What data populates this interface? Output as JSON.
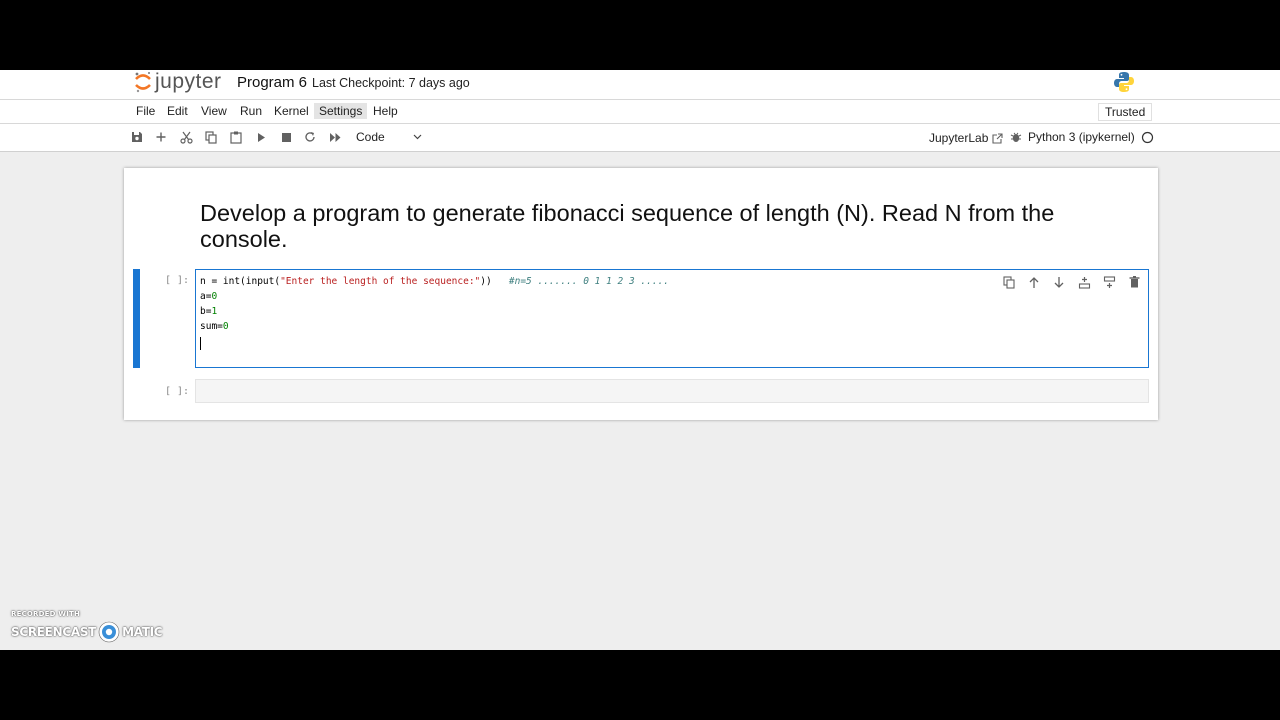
{
  "app": {
    "logo_text": "jupyter",
    "notebook_title": "Program 6",
    "checkpoint": "Last Checkpoint: 7 days ago"
  },
  "menu": {
    "items": [
      "File",
      "Edit",
      "View",
      "Run",
      "Kernel",
      "Settings",
      "Help"
    ],
    "active": "Settings",
    "trusted": "Trusted"
  },
  "toolbar": {
    "icons": [
      "save-icon",
      "add-cell-icon",
      "cut-icon",
      "copy-icon",
      "paste-icon",
      "run-icon",
      "stop-icon",
      "restart-icon",
      "run-all-icon"
    ],
    "cell_type": "Code",
    "jupyterlab_link": "JupyterLab",
    "kernel_name": "Python 3 (ipykernel)",
    "kernel_state": "idle"
  },
  "cells": {
    "markdown_text": "Develop a program to generate fibonacci sequence of length (N). Read N from the console.",
    "code_prompt": "[ ]:",
    "code_lines": {
      "l1_a": "n = int(input(",
      "l1_str": "\"Enter the length of the sequence:\"",
      "l1_b": "))   ",
      "l1_comment": "#n=5 ....... 0 1 1 2 3 .....",
      "l2_a": "a=",
      "l2_num": "0",
      "l3_a": "b=",
      "l3_num": "1",
      "l4_a": "sum=",
      "l4_num": "0"
    },
    "empty_prompt": "[ ]:",
    "cell_tool_icons": [
      "duplicate-icon",
      "move-up-icon",
      "move-down-icon",
      "insert-above-icon",
      "insert-below-icon",
      "delete-icon"
    ]
  },
  "watermark": {
    "line1": "RECORDED WITH",
    "line2a": "SCREENCAST",
    "line2b": "MATIC"
  },
  "colors": {
    "accent": "#1976d2",
    "logo_orange": "#f37726"
  }
}
